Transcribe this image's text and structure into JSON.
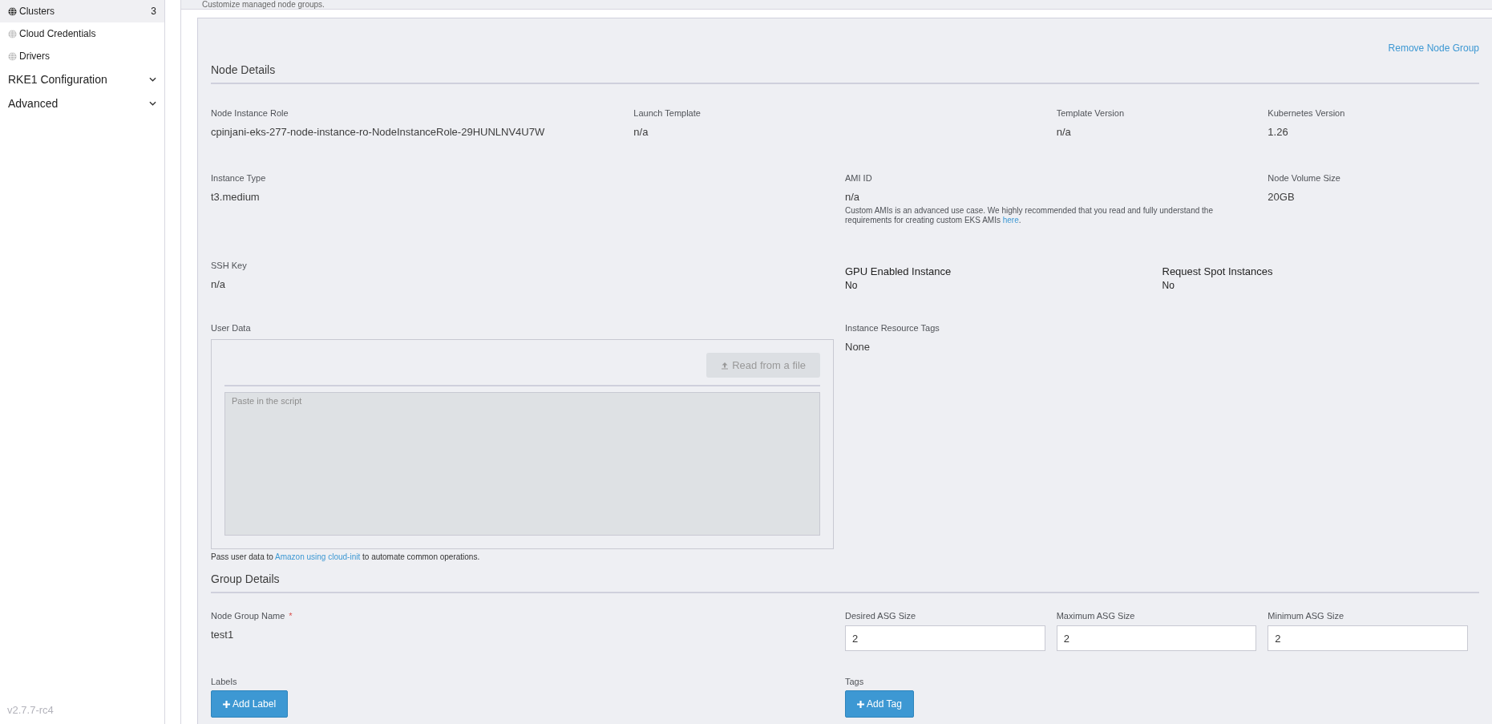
{
  "sidebar": {
    "items": [
      {
        "kind": "link",
        "label": "Clusters",
        "count": "3",
        "selected": true
      },
      {
        "kind": "link",
        "label": "Cloud Credentials",
        "selected": false
      },
      {
        "kind": "link",
        "label": "Drivers",
        "selected": false
      },
      {
        "kind": "group",
        "label": "RKE1 Configuration",
        "expanded": false
      },
      {
        "kind": "group",
        "label": "Advanced",
        "expanded": false
      }
    ],
    "version": "v2.7.7-rc4"
  },
  "header": {
    "subtitle": "Customize managed node groups."
  },
  "node_details": {
    "title": "Node Details",
    "remove_link": "Remove Node Group",
    "rows": [
      {
        "fields": [
          {
            "kind": "text",
            "label": "Node Instance Role",
            "value": "cpinjani-eks-277-node-instance-ro-NodeInstanceRole-29HUNLNV4U7W"
          },
          {
            "kind": "text",
            "label": "Launch Template",
            "value": "n/a"
          },
          {
            "kind": "text",
            "label": "Template Version",
            "value": "n/a"
          },
          {
            "kind": "text",
            "label": "Kubernetes Version",
            "value": "1.26"
          }
        ]
      },
      {
        "fields": [
          {
            "kind": "text",
            "label": "Instance Type",
            "value": "t3.medium"
          },
          {
            "kind": "note",
            "label": "AMI ID",
            "value": "n/a",
            "note_before": "Custom AMIs is an advanced use case. We highly recommended that you read and fully understand the requirements for creating custom EKS AMIs ",
            "note_link": "here",
            "note_after": "."
          },
          {
            "kind": "text",
            "label": "Node Volume Size",
            "value": "20GB"
          }
        ]
      },
      {
        "fields": [
          {
            "kind": "text",
            "label": "SSH Key",
            "value": "n/a"
          },
          {
            "kind": "strong",
            "label": "GPU Enabled Instance",
            "value": "No"
          },
          {
            "kind": "strong",
            "label": "Request Spot Instances",
            "value": "No"
          }
        ]
      }
    ],
    "user_data": {
      "label": "User Data",
      "button": "Read from a file",
      "button_disabled": true,
      "placeholder": "Paste in the script",
      "help_before": "Pass user data to ",
      "help_link": "Amazon using cloud-init",
      "help_after": " to automate common operations."
    },
    "resource_tags": {
      "label": "Instance Resource Tags",
      "value": "None"
    }
  },
  "group_details": {
    "title": "Group Details",
    "fields": [
      {
        "kind": "text",
        "label": "Node Group Name",
        "value": "test1",
        "required_mark": "*"
      },
      {
        "kind": "input",
        "label": "Desired ASG Size",
        "value": "2"
      },
      {
        "kind": "input",
        "label": "Maximum ASG Size",
        "value": "2"
      },
      {
        "kind": "input",
        "label": "Minimum ASG Size",
        "value": "2"
      }
    ],
    "adders": [
      {
        "label": "Labels",
        "button": "Add Label"
      },
      {
        "label": "Tags",
        "button": "Add Tag"
      }
    ]
  }
}
